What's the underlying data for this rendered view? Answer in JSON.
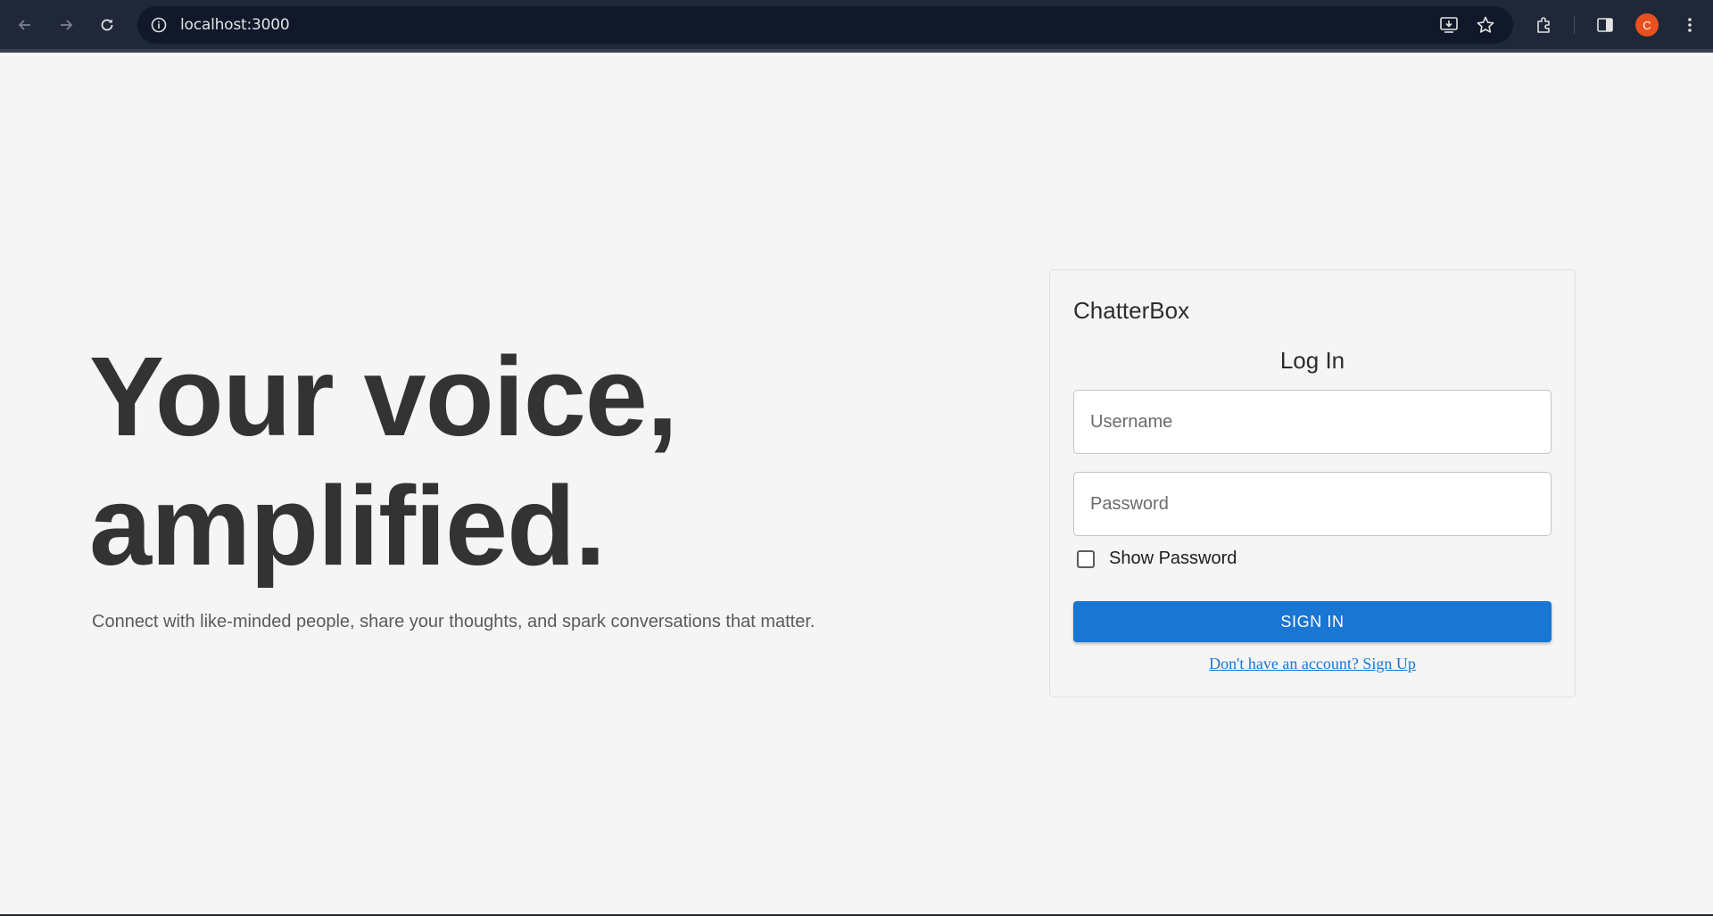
{
  "browser": {
    "url": "localhost:3000",
    "profile_initial": "C",
    "profile_color": "#e8501f",
    "icons": {
      "back": "back-arrow-icon",
      "forward": "forward-arrow-icon",
      "reload": "reload-icon",
      "site_info": "info-icon",
      "install": "install-app-icon",
      "bookmark": "star-icon",
      "extensions": "puzzle-icon",
      "side_panel": "side-panel-icon",
      "menu": "kebab-menu-icon"
    }
  },
  "hero": {
    "title_line1": "Your voice,",
    "title_line2": "amplified.",
    "subtitle": "Connect with like-minded people, share your thoughts, and spark conversations that matter."
  },
  "login": {
    "brand": "ChatterBox",
    "title": "Log In",
    "username_placeholder": "Username",
    "username_value": "",
    "password_placeholder": "Password",
    "password_value": "",
    "show_password_label": "Show Password",
    "show_password_checked": false,
    "submit_label": "SIGN IN",
    "signup_link": "Don't have an account? Sign Up",
    "accent_color": "#1976d2"
  }
}
